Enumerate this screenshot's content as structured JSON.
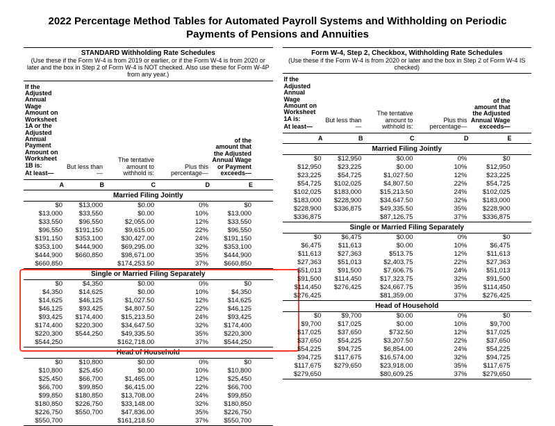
{
  "doc_title": "2022 Percentage Method Tables for Automated Payroll Systems and Withholding on Periodic Payments of Pensions and Annuities",
  "left": {
    "schedule_title": "STANDARD Withholding Rate Schedules",
    "schedule_sub": "(Use these if the Form W-4 is from 2019 or earlier, or if the Form W-4 is from 2020 or later and the box in Step 2 of Form W-4 is NOT checked. Also use these for Form W-4P from any year.)",
    "intro1": "If the Adjusted Annual Wage Amount on Worksheet 1A or the Adjusted Annual Payment Amount on Worksheet 1B is:",
    "intro4a": "of the amount that the Adjusted Annual Wage or Payment",
    "h_atleast": "At least—",
    "h_less": "But less than—",
    "h_tent": "The tentative amount to withhold is:",
    "h_plus": "Plus this percentage—",
    "h_exc": "exceeds—",
    "letters": [
      "A",
      "B",
      "C",
      "D",
      "E"
    ],
    "sections": [
      {
        "title": "Married Filing Jointly",
        "rows": [
          [
            "$0",
            "$13,000",
            "$0.00",
            "0%",
            "$0"
          ],
          [
            "$13,000",
            "$33,550",
            "$0.00",
            "10%",
            "$13,000"
          ],
          [
            "$33,550",
            "$96,550",
            "$2,055.00",
            "12%",
            "$33,550"
          ],
          [
            "$96,550",
            "$191,150",
            "$9,615.00",
            "22%",
            "$96,550"
          ],
          [
            "$191,150",
            "$353,100",
            "$30,427.00",
            "24%",
            "$191,150"
          ],
          [
            "$353,100",
            "$444,900",
            "$69,295.00",
            "32%",
            "$353,100"
          ],
          [
            "$444,900",
            "$660,850",
            "$98,671.00",
            "35%",
            "$444,900"
          ],
          [
            "$660,850",
            "",
            "$174,253.50",
            "37%",
            "$660,850"
          ]
        ]
      },
      {
        "title": "Single or Married Filing Separately",
        "rows": [
          [
            "$0",
            "$4,350",
            "$0.00",
            "0%",
            "$0"
          ],
          [
            "$4,350",
            "$14,625",
            "$0.00",
            "10%",
            "$4,350"
          ],
          [
            "$14,625",
            "$46,125",
            "$1,027.50",
            "12%",
            "$14,625"
          ],
          [
            "$46,125",
            "$93,425",
            "$4,807.50",
            "22%",
            "$46,125"
          ],
          [
            "$93,425",
            "$174,400",
            "$15,213.50",
            "24%",
            "$93,425"
          ],
          [
            "$174,400",
            "$220,300",
            "$34,647.50",
            "32%",
            "$174,400"
          ],
          [
            "$220,300",
            "$544,250",
            "$49,335.50",
            "35%",
            "$220,300"
          ],
          [
            "$544,250",
            "",
            "$162,718.00",
            "37%",
            "$544,250"
          ]
        ]
      },
      {
        "title": "Head of Household",
        "rows": [
          [
            "$0",
            "$10,800",
            "$0.00",
            "0%",
            "$0"
          ],
          [
            "$10,800",
            "$25,450",
            "$0.00",
            "10%",
            "$10,800"
          ],
          [
            "$25,450",
            "$66,700",
            "$1,465.00",
            "12%",
            "$25,450"
          ],
          [
            "$66,700",
            "$99,850",
            "$6,415.00",
            "22%",
            "$66,700"
          ],
          [
            "$99,850",
            "$180,850",
            "$13,708.00",
            "24%",
            "$99,850"
          ],
          [
            "$180,850",
            "$226,750",
            "$33,148.00",
            "32%",
            "$180,850"
          ],
          [
            "$226,750",
            "$550,700",
            "$47,836.00",
            "35%",
            "$226,750"
          ],
          [
            "$550,700",
            "",
            "$161,218.50",
            "37%",
            "$550,700"
          ]
        ]
      }
    ]
  },
  "right": {
    "schedule_title": "Form W-4, Step 2, Checkbox, Withholding Rate Schedules",
    "schedule_sub": "(Use these if the Form W-4 is from 2020 or later and the box in Step 2 of Form W-4 IS checked)",
    "intro1": "If the Adjusted Annual Wage Amount on Worksheet 1A is:",
    "intro4a": "of the amount that the Adjusted Annual Wage",
    "h_atleast": "At least—",
    "h_less": "But less than—",
    "h_tent": "The tentative amount to withhold is:",
    "h_plus": "Plus this percentage—",
    "h_exc": "exceeds—",
    "letters": [
      "A",
      "B",
      "C",
      "D",
      "E"
    ],
    "sections": [
      {
        "title": "Married Filing Jointly",
        "rows": [
          [
            "$0",
            "$12,950",
            "$0.00",
            "0%",
            "$0"
          ],
          [
            "$12,950",
            "$23,225",
            "$0.00",
            "10%",
            "$12,950"
          ],
          [
            "$23,225",
            "$54,725",
            "$1,027.50",
            "12%",
            "$23,225"
          ],
          [
            "$54,725",
            "$102,025",
            "$4,807.50",
            "22%",
            "$54,725"
          ],
          [
            "$102,025",
            "$183,000",
            "$15,213.50",
            "24%",
            "$102,025"
          ],
          [
            "$183,000",
            "$228,900",
            "$34,647.50",
            "32%",
            "$183,000"
          ],
          [
            "$228,900",
            "$336,875",
            "$49,335.50",
            "35%",
            "$228,900"
          ],
          [
            "$336,875",
            "",
            "$87,126.75",
            "37%",
            "$336,875"
          ]
        ]
      },
      {
        "title": "Single or Married Filing Separately",
        "rows": [
          [
            "$0",
            "$6,475",
            "$0.00",
            "0%",
            "$0"
          ],
          [
            "$6,475",
            "$11,613",
            "$0.00",
            "10%",
            "$6,475"
          ],
          [
            "$11,613",
            "$27,363",
            "$513.75",
            "12%",
            "$11,613"
          ],
          [
            "$27,363",
            "$51,013",
            "$2,403.75",
            "22%",
            "$27,363"
          ],
          [
            "$51,013",
            "$91,500",
            "$7,606.75",
            "24%",
            "$51,013"
          ],
          [
            "$91,500",
            "$114,450",
            "$17,323.75",
            "32%",
            "$91,500"
          ],
          [
            "$114,450",
            "$276,425",
            "$24,667.75",
            "35%",
            "$114,450"
          ],
          [
            "$276,425",
            "",
            "$81,359.00",
            "37%",
            "$276,425"
          ]
        ]
      },
      {
        "title": "Head of Household",
        "rows": [
          [
            "$0",
            "$9,700",
            "$0.00",
            "0%",
            "$0"
          ],
          [
            "$9,700",
            "$17,025",
            "$0.00",
            "10%",
            "$9,700"
          ],
          [
            "$17,025",
            "$37,650",
            "$732.50",
            "12%",
            "$17,025"
          ],
          [
            "$37,650",
            "$54,225",
            "$3,207.50",
            "22%",
            "$37,650"
          ],
          [
            "$54,225",
            "$94,725",
            "$6,854.00",
            "24%",
            "$54,225"
          ],
          [
            "$94,725",
            "$117,675",
            "$16,574.00",
            "32%",
            "$94,725"
          ],
          [
            "$117,675",
            "$279,650",
            "$23,918.00",
            "35%",
            "$117,675"
          ],
          [
            "$279,650",
            "",
            "$80,609.25",
            "37%",
            "$279,650"
          ]
        ]
      }
    ]
  }
}
